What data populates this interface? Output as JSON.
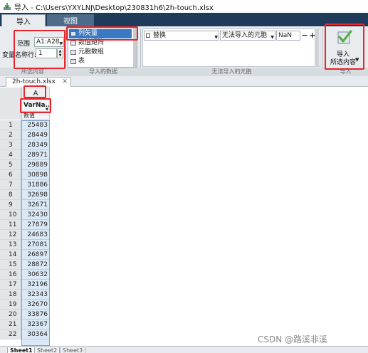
{
  "window": {
    "title": "导入 - C:\\Users\\YXYLNJ\\Desktop\\230831h6\\2h-touch.xlsx"
  },
  "tabs": [
    {
      "label": "导入",
      "active": true
    },
    {
      "label": "视图",
      "active": false
    }
  ],
  "selection": {
    "range_label": "范围",
    "range_value": "A1:A28...",
    "varnames_row_label": "变量名称行:",
    "varnames_row_value": "1",
    "section_label": "所选内容"
  },
  "output_type": {
    "section_label": "导入的数据",
    "options": [
      {
        "label": "列矢量",
        "selected": true
      },
      {
        "label": "数值矩阵",
        "selected": false
      },
      {
        "label": "元胞数组",
        "selected": false
      },
      {
        "label": "表",
        "selected": false
      }
    ]
  },
  "unimportable": {
    "section_label": "无法导入的元胞",
    "rule_action": "替换",
    "rule_condition": "无法导入的元胞",
    "replacement_value": "NaN",
    "remove_rule": "−",
    "add_rule": "+"
  },
  "import": {
    "line1": "导入",
    "line2": "所选内容",
    "section_label": "导入"
  },
  "document_tab": {
    "label": "2h-touch.xlsx",
    "close": "✕"
  },
  "spreadsheet": {
    "column_letter": "A",
    "variable_name": "VarNa...",
    "data_type": "数值",
    "rows": [
      {
        "n": "1",
        "v": "25483"
      },
      {
        "n": "2",
        "v": "28449"
      },
      {
        "n": "3",
        "v": "28349"
      },
      {
        "n": "4",
        "v": "28971"
      },
      {
        "n": "5",
        "v": "29889"
      },
      {
        "n": "6",
        "v": "30898"
      },
      {
        "n": "7",
        "v": "31886"
      },
      {
        "n": "8",
        "v": "32698"
      },
      {
        "n": "9",
        "v": "32671"
      },
      {
        "n": "10",
        "v": "32430"
      },
      {
        "n": "11",
        "v": "27879"
      },
      {
        "n": "12",
        "v": "24683"
      },
      {
        "n": "13",
        "v": "27081"
      },
      {
        "n": "14",
        "v": "26897"
      },
      {
        "n": "15",
        "v": "28872"
      },
      {
        "n": "16",
        "v": "30632"
      },
      {
        "n": "17",
        "v": "32196"
      },
      {
        "n": "18",
        "v": "32343"
      },
      {
        "n": "19",
        "v": "32670"
      },
      {
        "n": "20",
        "v": "33876"
      },
      {
        "n": "21",
        "v": "32367"
      },
      {
        "n": "22",
        "v": "30364"
      }
    ]
  },
  "sheets": [
    {
      "label": "Sheet1",
      "active": true
    },
    {
      "label": "Sheet2",
      "active": false
    },
    {
      "label": "Sheet3",
      "active": false
    }
  ],
  "watermark": "CSDN @路溪非溪",
  "colors": {
    "annotation": "#e8262d",
    "tabstrip": "#1f3b5c",
    "selection": "#3b78c4",
    "import_check": "#4caf3a"
  }
}
